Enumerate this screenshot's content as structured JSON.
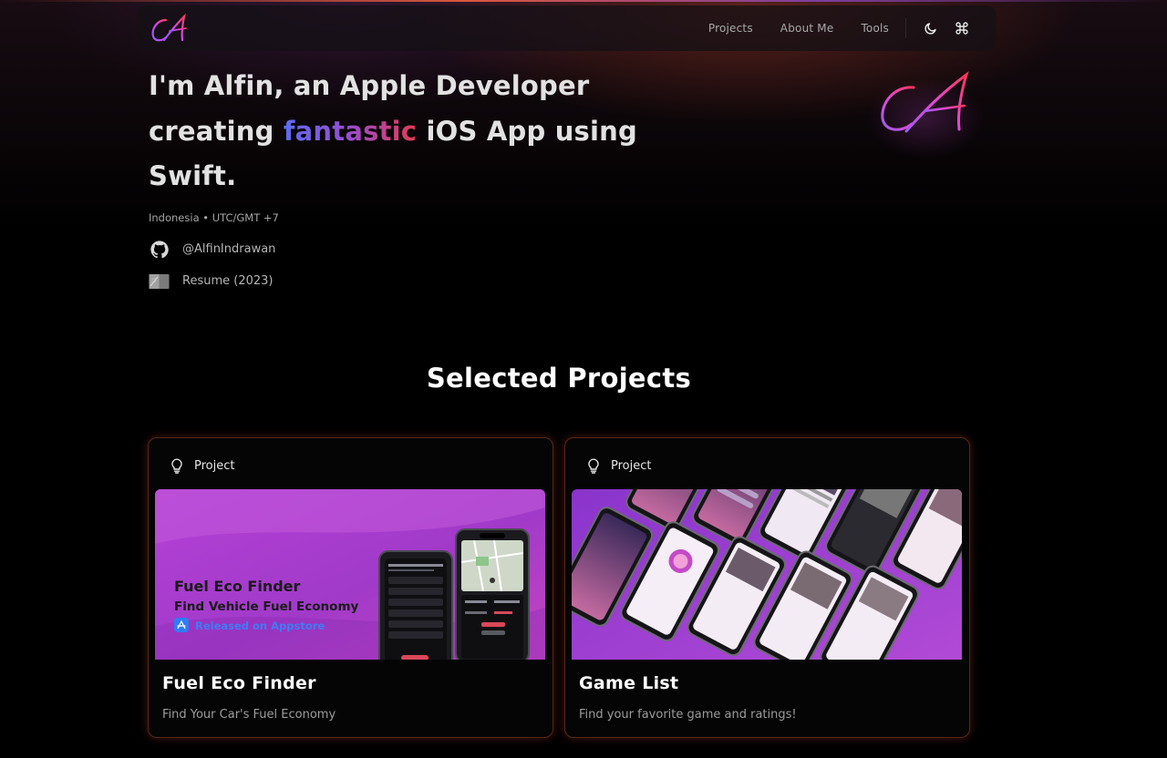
{
  "nav": {
    "links": [
      "Projects",
      "About Me",
      "Tools"
    ],
    "icons": [
      "moon-icon",
      "command-icon"
    ]
  },
  "logo": {
    "text": "CA"
  },
  "hero": {
    "title_before": "I'm Alfin, an Apple Developer creating ",
    "title_accent": "fantastic",
    "title_after": " iOS App using Swift.",
    "location": "Indonesia • UTC/GMT +7",
    "github": "@AlfinIndrawan",
    "resume": "Resume (2023)"
  },
  "projects": {
    "heading": "Selected Projects",
    "cards": [
      {
        "tag": "Project",
        "title": "Fuel Eco Finder",
        "description": "Find Your Car's Fuel Economy",
        "image": {
          "headline": "Fuel Eco Finder",
          "subheadline": "Find Vehicle Fuel Economy",
          "badge": "Released on Appstore"
        }
      },
      {
        "tag": "Project",
        "title": "Game List",
        "description": "Find your favorite game and ratings!"
      }
    ]
  },
  "colors": {
    "accent_gradient": [
      "#5b6cf0",
      "#9a4ccc",
      "#e23a52"
    ],
    "card_border": "#5a2518",
    "background": "#000000"
  }
}
